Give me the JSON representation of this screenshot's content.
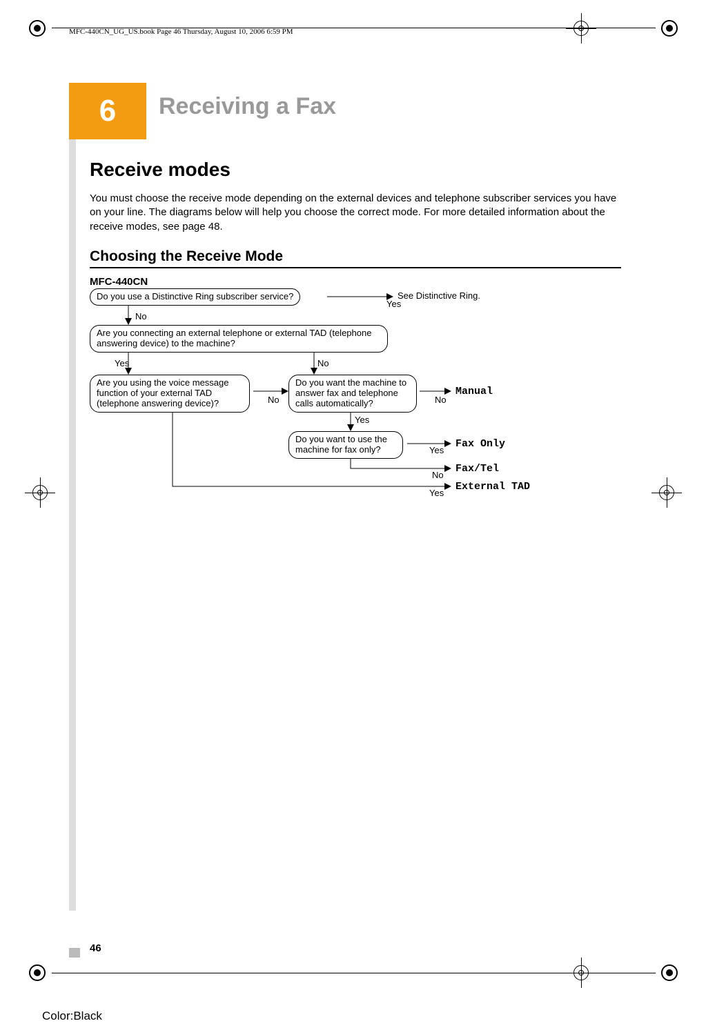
{
  "meta": {
    "header_line": "MFC-440CN_UG_US.book  Page 46  Thursday, August 10, 2006  6:59 PM"
  },
  "chapter": {
    "number": "6",
    "title": "Receiving a Fax"
  },
  "section": {
    "heading": "Receive modes",
    "body": "You must choose the receive mode depending on the external devices and telephone subscriber services you have on your line. The diagrams below will help you choose the correct mode. For more detailed information about the receive modes, see page 48."
  },
  "subsection": {
    "heading": "Choosing the Receive Mode",
    "model": "MFC-440CN"
  },
  "flow": {
    "q1": "Do you use a Distinctive Ring subscriber service?",
    "q1_yes": "Yes",
    "q1_no": "No",
    "q2": "Are you connecting an external telephone or external TAD (telephone answering device) to the machine?",
    "q2_yes": "Yes",
    "q2_no": "No",
    "q3": "Are you using the voice message function of your external TAD (telephone answering device)?",
    "q3_no": "No",
    "q4": "Do you want the machine to answer fax and telephone calls automatically?",
    "q4_yes": "Yes",
    "q4_no": "No",
    "q5": "Do you want to use the machine for fax only?",
    "q5_yes": "Yes",
    "q5_no": "No",
    "result_distinctive": "See Distinctive Ring.",
    "result_manual": "Manual",
    "result_faxonly": "Fax Only",
    "result_faxtel": "Fax/Tel",
    "result_external": "External TAD",
    "tad_yes": "Yes"
  },
  "footer": {
    "page": "46",
    "color": "Color:Black"
  }
}
